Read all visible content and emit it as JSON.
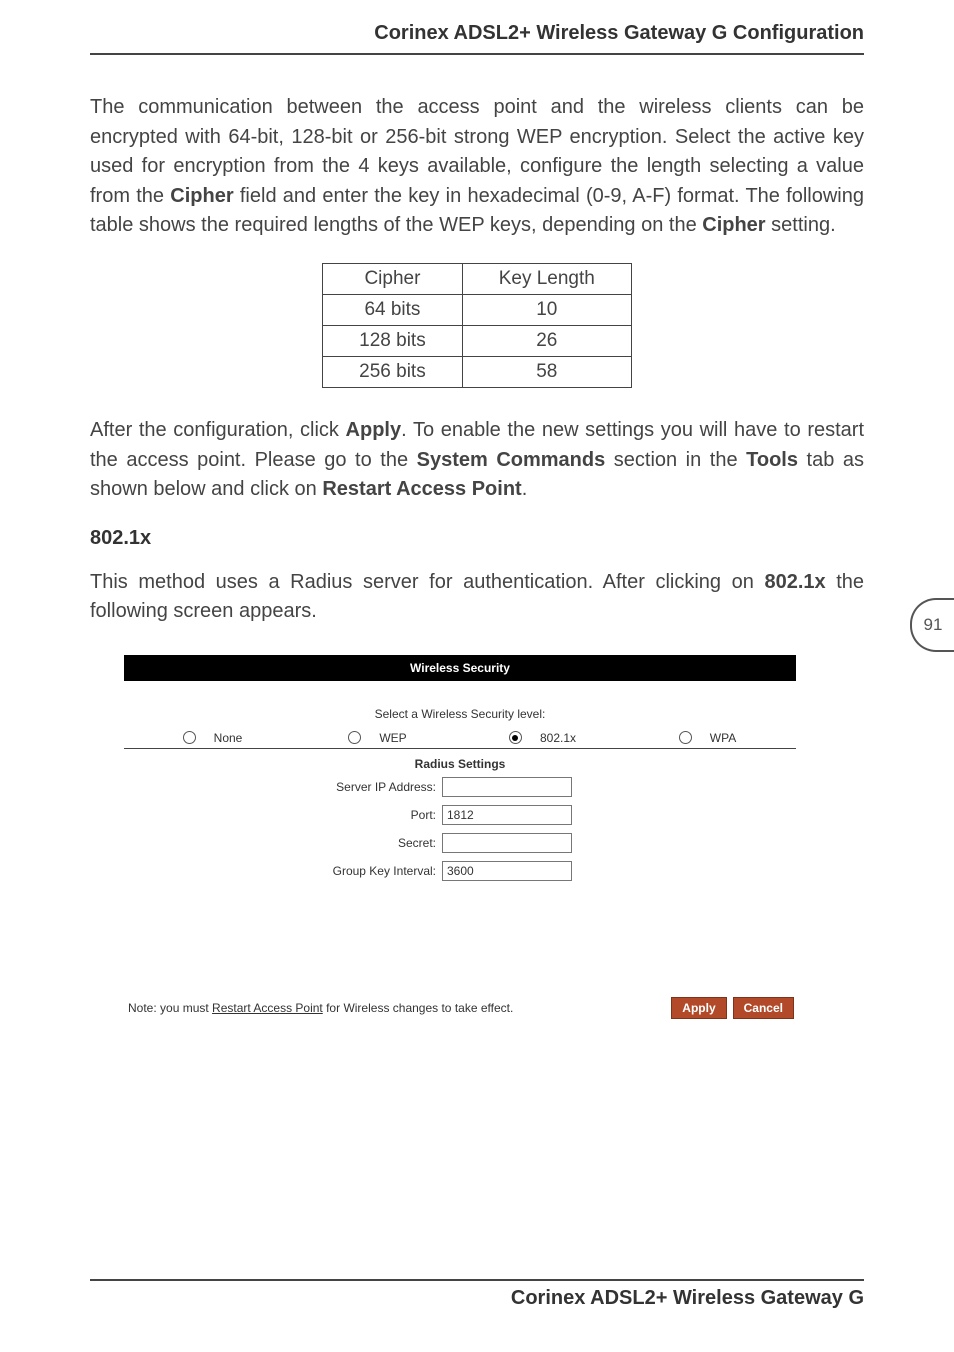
{
  "header": {
    "title": "Corinex ADSL2+ Wireless Gateway G Configuration"
  },
  "page_number": "91",
  "para1": {
    "t1": "The communication between the access point and the wireless clients can be encrypted with 64-bit, 128-bit or 256-bit strong WEP encryption. Select the active key used for encryption from the 4 keys available, configure the length selecting a value from the ",
    "b1": "Cipher",
    "t2": " field and enter the key in hexadecimal (0-9, A-F) format. The following table shows the required lengths of the WEP keys, depending on the ",
    "b2": "Cipher",
    "t3": " setting."
  },
  "cipher_table": {
    "headers": {
      "c1": "Cipher",
      "c2": "Key Length"
    },
    "rows": [
      {
        "c1": "64 bits",
        "c2": "10"
      },
      {
        "c1": "128 bits",
        "c2": "26"
      },
      {
        "c1": "256 bits",
        "c2": "58"
      }
    ]
  },
  "para2": {
    "t1": "After the configuration, click ",
    "b1": "Apply",
    "t2": ". To enable the new settings you will have to restart the access point. Please go to the ",
    "b2": "System Commands",
    "t3": " section in the ",
    "b3": "Tools",
    "t4": " tab as shown below and click on ",
    "b4": "Restart Access Point",
    "t5": "."
  },
  "subhead": "802.1x",
  "para3": {
    "t1": "This method uses a Radius server for authentication. After clicking on ",
    "b1": "802.1x",
    "t2": " the following screen appears."
  },
  "screenshot": {
    "title": "Wireless Security",
    "select_label": "Select a Wireless Security level:",
    "options": {
      "none": {
        "label": "None",
        "checked": false
      },
      "wep": {
        "label": "WEP",
        "checked": false
      },
      "dot1x": {
        "label": "802.1x",
        "checked": true
      },
      "wpa": {
        "label": "WPA",
        "checked": false
      }
    },
    "radius_heading": "Radius Settings",
    "fields": {
      "server_ip": {
        "label": "Server IP Address:",
        "value": ""
      },
      "port": {
        "label": "Port:",
        "value": "1812"
      },
      "secret": {
        "label": "Secret:",
        "value": ""
      },
      "gki": {
        "label": "Group Key Interval:",
        "value": "3600"
      }
    },
    "note": {
      "pre": "Note: you must ",
      "link": "Restart Access Point",
      "post": " for Wireless changes to take effect."
    },
    "buttons": {
      "apply": "Apply",
      "cancel": "Cancel"
    }
  },
  "footer": {
    "title": "Corinex ADSL2+ Wireless Gateway G"
  }
}
